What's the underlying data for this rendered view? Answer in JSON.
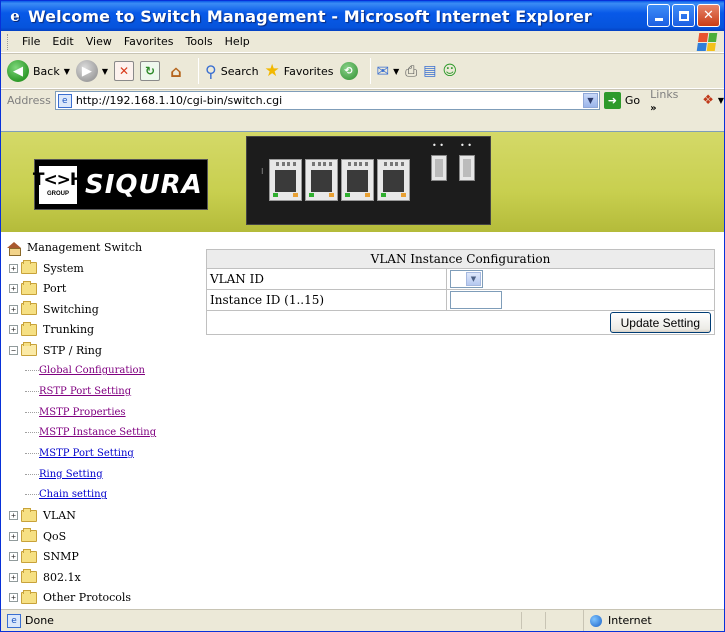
{
  "window": {
    "title": "Welcome to Switch Management - Microsoft Internet Explorer",
    "icon": "ie-icon"
  },
  "menu": [
    "File",
    "Edit",
    "View",
    "Favorites",
    "Tools",
    "Help"
  ],
  "toolbar": {
    "back_label": "Back",
    "search_label": "Search",
    "favorites_label": "Favorites"
  },
  "address": {
    "label": "Address",
    "url": "http://192.168.1.10/cgi-bin/switch.cgi",
    "go_label": "Go",
    "links_label": "Links"
  },
  "banner": {
    "logo_tk": "T<>H",
    "logo_group": "GROUP",
    "logo_name": "SIQURA"
  },
  "sidebar": {
    "root": "Management Switch",
    "items": [
      {
        "label": "System"
      },
      {
        "label": "Port"
      },
      {
        "label": "Switching"
      },
      {
        "label": "Trunking"
      },
      {
        "label": "STP / Ring",
        "expanded": true
      }
    ],
    "sub_items": [
      {
        "label": "Global Configuration",
        "visited": true
      },
      {
        "label": "RSTP Port Setting",
        "visited": true
      },
      {
        "label": "MSTP Properties",
        "visited": true
      },
      {
        "label": "MSTP Instance Setting",
        "visited": true
      },
      {
        "label": "MSTP Port Setting",
        "visited": false
      },
      {
        "label": "Ring Setting",
        "visited": false
      },
      {
        "label": "Chain setting",
        "visited": false
      }
    ],
    "items_after": [
      {
        "label": "VLAN"
      },
      {
        "label": "QoS"
      },
      {
        "label": "SNMP"
      },
      {
        "label": "802.1x"
      },
      {
        "label": "Other Protocols"
      }
    ]
  },
  "config": {
    "heading": "VLAN Instance Configuration",
    "vlan_id_label": "VLAN ID",
    "instance_id_label": "Instance ID (1..15)",
    "update_button": "Update Setting"
  },
  "status": {
    "text": "Done",
    "zone": "Internet"
  },
  "colors": {
    "titlebar": "#0859E8",
    "banner": "#C8CF4F",
    "link": "#0000CC",
    "visited_link": "#800080"
  }
}
